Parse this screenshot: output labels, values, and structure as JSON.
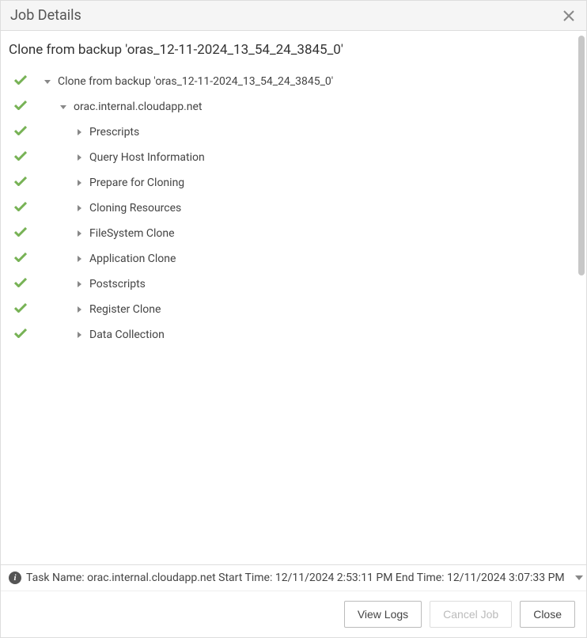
{
  "header": {
    "title": "Job Details"
  },
  "job": {
    "subtitle": "Clone from backup 'oras_12-11-2024_13_54_24_3845_0'"
  },
  "tree": [
    {
      "indent": 0,
      "arrow": "down",
      "label": "Clone from backup 'oras_12-11-2024_13_54_24_3845_0'",
      "status": "success"
    },
    {
      "indent": 1,
      "arrow": "down",
      "label": "orac.internal.cloudapp.net",
      "status": "success"
    },
    {
      "indent": 2,
      "arrow": "right",
      "label": "Prescripts",
      "status": "success"
    },
    {
      "indent": 2,
      "arrow": "right",
      "label": "Query Host Information",
      "status": "success"
    },
    {
      "indent": 2,
      "arrow": "right",
      "label": "Prepare for Cloning",
      "status": "success"
    },
    {
      "indent": 2,
      "arrow": "right",
      "label": "Cloning Resources",
      "status": "success"
    },
    {
      "indent": 2,
      "arrow": "right",
      "label": "FileSystem Clone",
      "status": "success"
    },
    {
      "indent": 2,
      "arrow": "right",
      "label": "Application Clone",
      "status": "success"
    },
    {
      "indent": 2,
      "arrow": "right",
      "label": "Postscripts",
      "status": "success"
    },
    {
      "indent": 2,
      "arrow": "right",
      "label": "Register Clone",
      "status": "success"
    },
    {
      "indent": 2,
      "arrow": "right",
      "label": "Data Collection",
      "status": "success"
    }
  ],
  "statusbar": {
    "text": "Task Name: orac.internal.cloudapp.net Start Time: 12/11/2024 2:53:11 PM End Time: 12/11/2024 3:07:33 PM"
  },
  "buttons": {
    "viewLogs": "View Logs",
    "cancelJob": "Cancel Job",
    "close": "Close"
  }
}
